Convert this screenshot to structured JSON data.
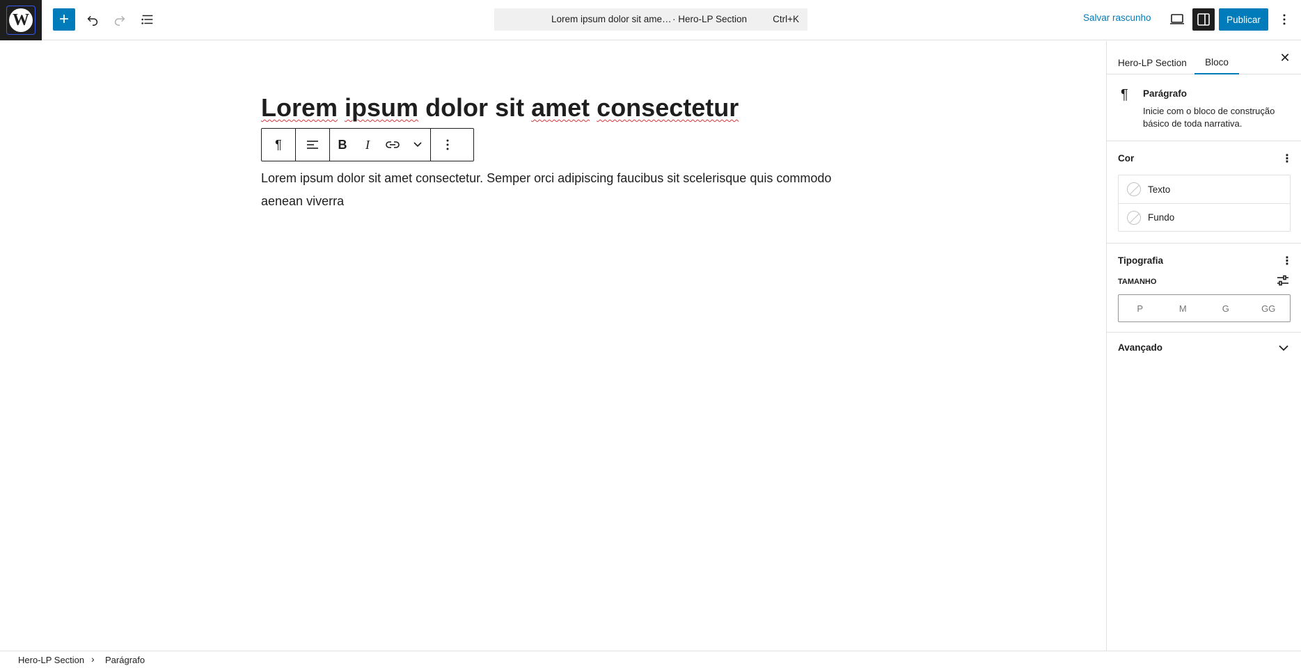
{
  "topbar": {
    "logo_letter": "W",
    "add_block": "+",
    "command_bar": {
      "title": "Lorem ipsum dolor sit ame…",
      "type": "· Hero-LP Section",
      "shortcut": "Ctrl+K"
    },
    "save_draft": "Salvar rascunho",
    "publish": "Publicar"
  },
  "editor": {
    "title_words": [
      "Lorem",
      "ipsum",
      "dolor",
      "sit",
      "amet",
      "consectetur"
    ],
    "paragraph": "Lorem ipsum dolor sit amet consectetur. Semper orci adipiscing faucibus sit scelerisque quis commodo aenean viverra"
  },
  "sidebar": {
    "tabs": [
      "Hero-LP Section",
      "Bloco"
    ],
    "active_tab": "Bloco",
    "block": {
      "name": "Parágrafo",
      "description": "Inicie com o bloco de construção básico de toda narrativa."
    },
    "color_panel": {
      "title": "Cor",
      "items": [
        "Texto",
        "Fundo"
      ]
    },
    "typography_panel": {
      "title": "Tipografia",
      "size_label": "Tamanho",
      "sizes": [
        "P",
        "M",
        "G",
        "GG"
      ]
    },
    "advanced_panel": {
      "title": "Avançado"
    }
  },
  "footer": {
    "breadcrumbs": [
      "Hero-LP Section",
      "Parágrafo"
    ]
  },
  "colors": {
    "accent": "#007cba",
    "dark": "#1e1e1e",
    "spellcheck": "#d63638"
  }
}
